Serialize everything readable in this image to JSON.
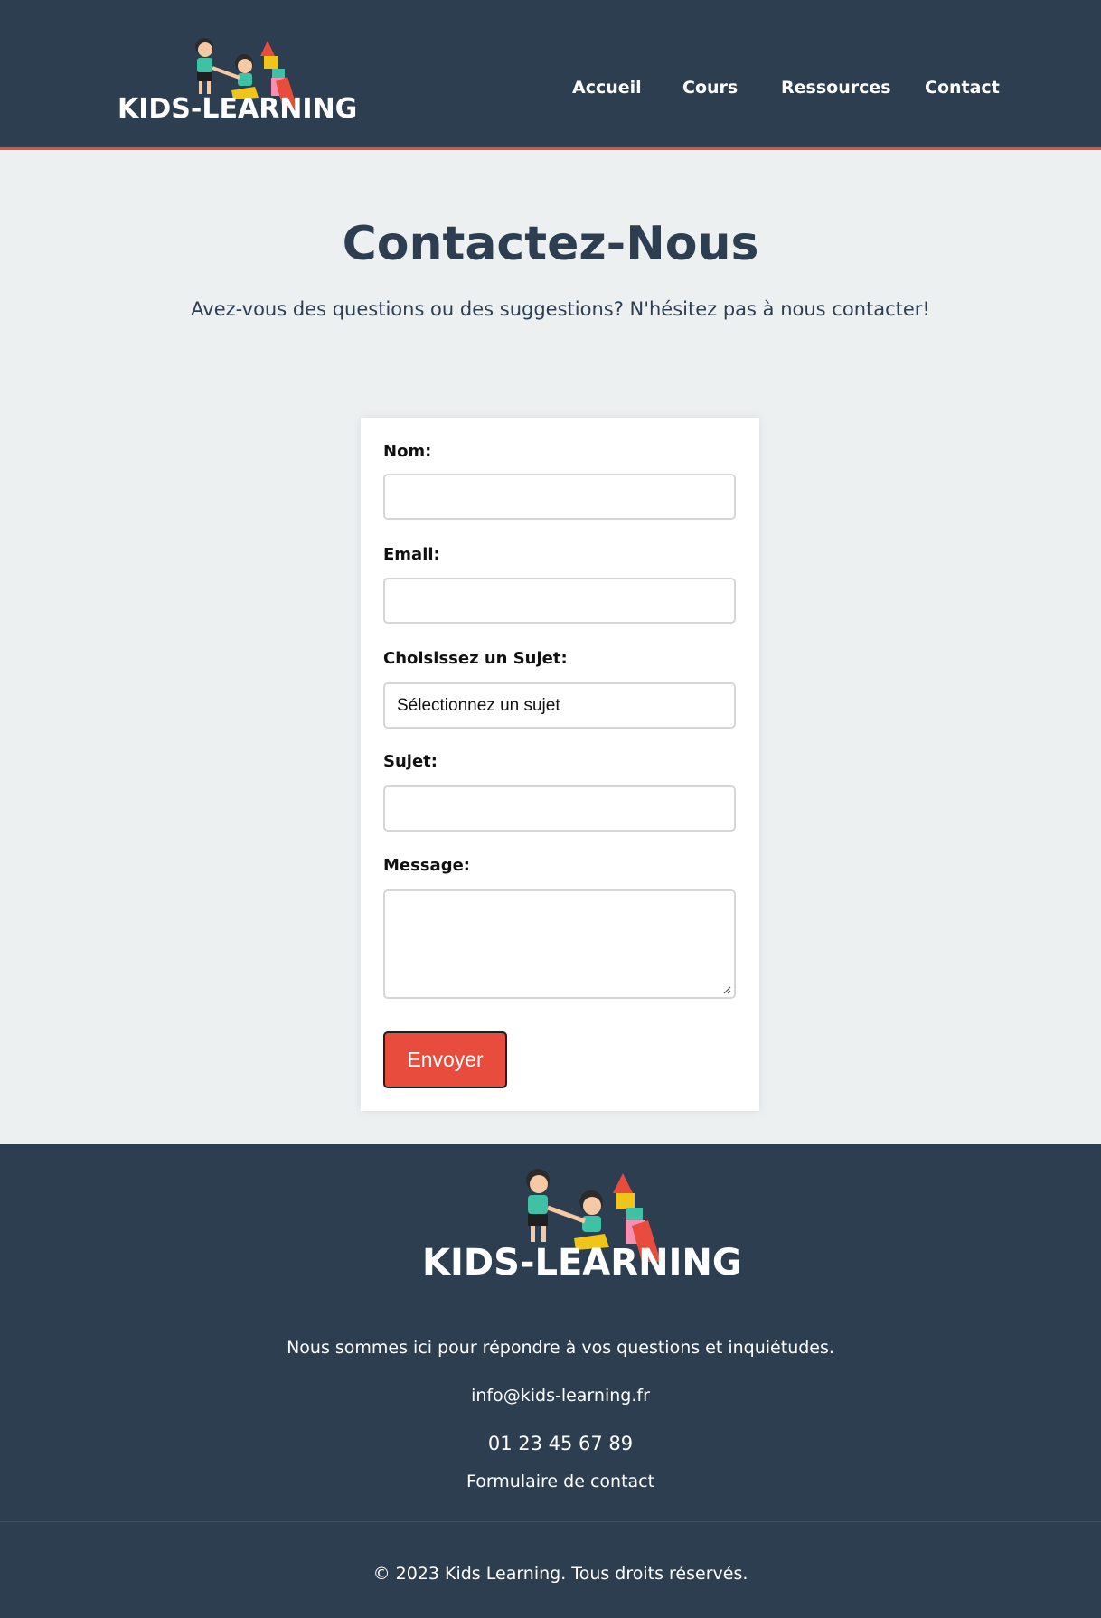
{
  "header": {
    "logo_text": "KIDS-LEARNING",
    "nav": [
      "Accueil",
      "Cours",
      "Ressources",
      "Contact"
    ]
  },
  "hero": {
    "title": "Contactez-Nous",
    "intro": "Avez-vous des questions ou des suggestions? N'hésitez pas à nous contacter!"
  },
  "form": {
    "name_label": "Nom:",
    "email_label": "Email:",
    "topic_label": "Choisissez un Sujet:",
    "topic_selected": "Sélectionnez un sujet",
    "subject_label": "Sujet:",
    "message_label": "Message:",
    "submit_label": "Envoyer"
  },
  "footer": {
    "logo_text": "KIDS-LEARNING",
    "tagline": "Nous sommes ici pour répondre à vos questions et inquiétudes.",
    "email": "info@kids-learning.fr",
    "phone": "01 23 45 67 89",
    "contact_link": "Formulaire de contact",
    "copyright": "© 2023 Kids Learning. Tous droits réservés."
  },
  "colors": {
    "header_bg": "#2c3e50",
    "page_bg": "#ecf0f1",
    "accent": "#e74c3c",
    "text": "#2c3e50"
  },
  "icons": [
    "kids-illustration-icon"
  ]
}
